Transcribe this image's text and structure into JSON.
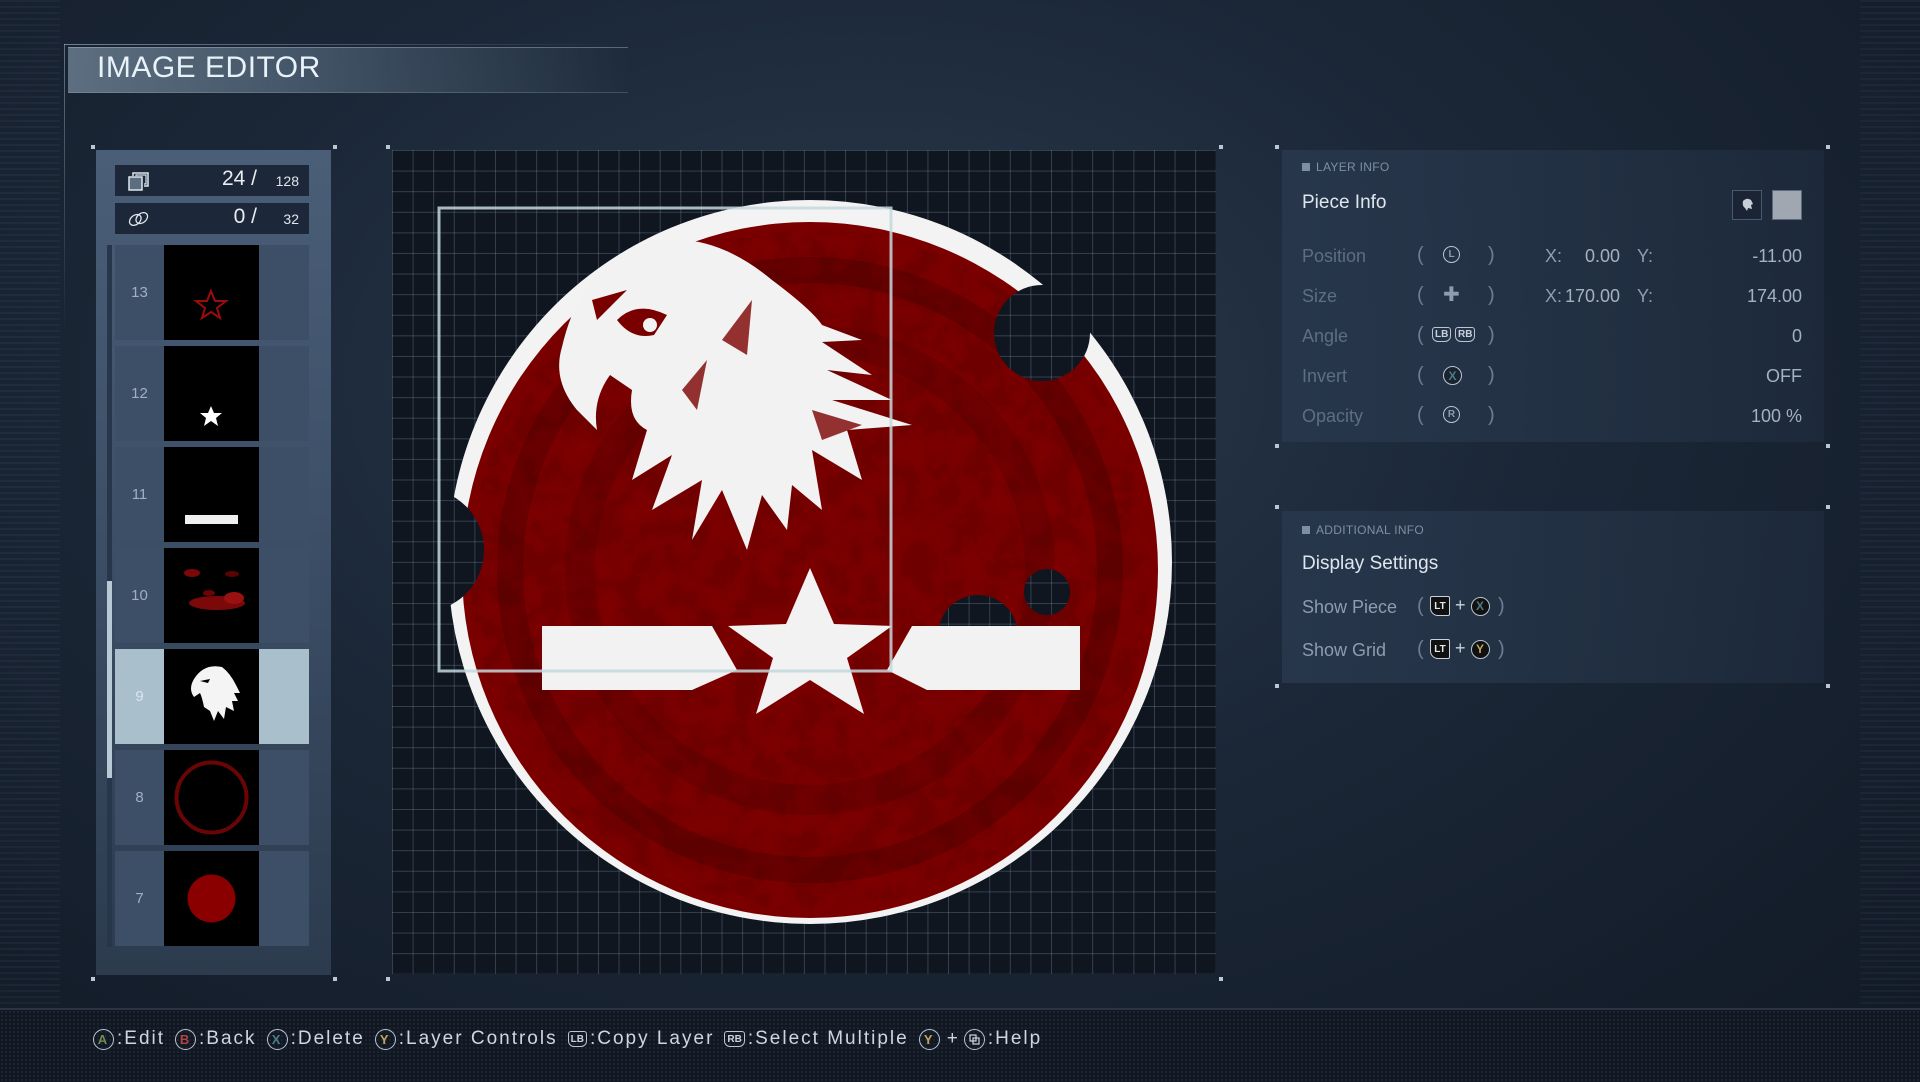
{
  "header": {
    "title": "IMAGE EDITOR"
  },
  "counters": {
    "layers": {
      "icon": "layers-icon",
      "current": "24 /",
      "max": "128"
    },
    "links": {
      "icon": "link-icon",
      "current": "0 /",
      "max": "32"
    }
  },
  "layer_list": {
    "scroll_position": 0.48,
    "selected": "9",
    "layers": [
      {
        "number": "13",
        "thumbnail": "red-star-outline"
      },
      {
        "number": "12",
        "thumbnail": "white-star"
      },
      {
        "number": "11",
        "thumbnail": "white-bar"
      },
      {
        "number": "10",
        "thumbnail": "red-grunge-texture"
      },
      {
        "number": "9",
        "thumbnail": "white-eagle-head"
      },
      {
        "number": "8",
        "thumbnail": "red-ring"
      },
      {
        "number": "7",
        "thumbnail": "red-circle"
      }
    ]
  },
  "canvas": {
    "emblem": "eagle-star-roundel",
    "colors": {
      "primary": "#7a0000",
      "dark": "#5a0000",
      "white": "#f2f2f2",
      "selection": "#c4d8de"
    }
  },
  "layer_info": {
    "section_label": "LAYER INFO",
    "title": "Piece Info",
    "piece_color": "#a1a7b0",
    "properties": [
      {
        "label": "Position",
        "control": "left-stick",
        "x_label": "X:",
        "x": "0.00",
        "y_label": "Y:",
        "y": "-11.00"
      },
      {
        "label": "Size",
        "control": "d-pad",
        "x_label": "X:",
        "x": "170.00",
        "y_label": "Y:",
        "y": "174.00"
      },
      {
        "label": "Angle",
        "control": "LB RB",
        "value": "0"
      },
      {
        "label": "Invert",
        "control": "X",
        "value": "OFF"
      },
      {
        "label": "Opacity",
        "control": "R",
        "value": "100 %"
      }
    ]
  },
  "additional_info": {
    "section_label": "ADDITIONAL INFO",
    "title": "Display Settings",
    "settings": [
      {
        "label": "Show Piece",
        "trigger": "LT",
        "plus": "+",
        "button": "X"
      },
      {
        "label": "Show Grid",
        "trigger": "LT",
        "plus": "+",
        "button": "Y"
      }
    ]
  },
  "footer": {
    "hints": [
      {
        "button": "A",
        "color": "#6f8a55",
        "label": ":Edit"
      },
      {
        "button": "B",
        "color": "#b24444",
        "label": ":Back"
      },
      {
        "button": "X",
        "color": "#4c7c86",
        "label": ":Delete"
      },
      {
        "button": "Y",
        "color": "#c2a45a",
        "label": ":Layer Controls"
      },
      {
        "button": "LB",
        "label": ":Copy Layer"
      },
      {
        "button": "RB",
        "label": ":Select Multiple"
      },
      {
        "button": "Y",
        "color": "#c2a45a",
        "plus": "+",
        "button2": "view",
        "label": ":Help"
      }
    ]
  },
  "paren_open": "(",
  "paren_close": ")"
}
